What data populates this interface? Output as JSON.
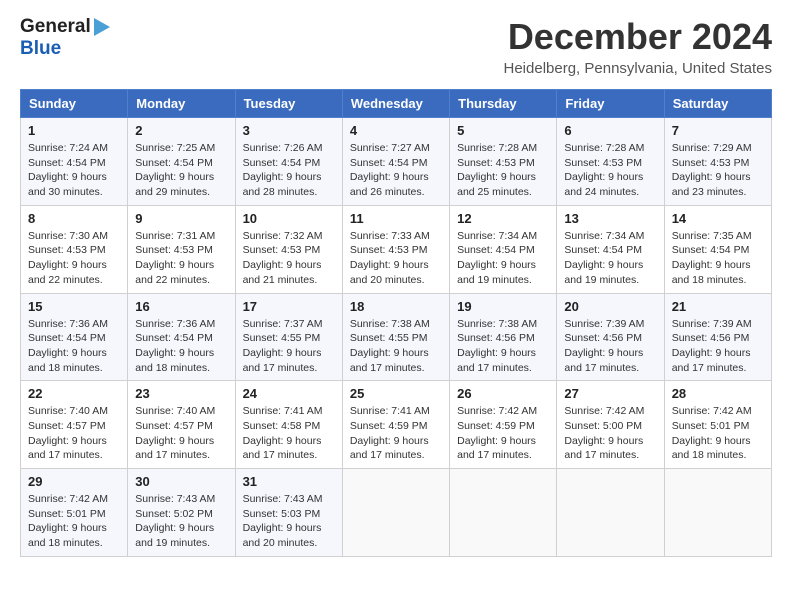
{
  "header": {
    "logo_general": "General",
    "logo_blue": "Blue",
    "title": "December 2024",
    "subtitle": "Heidelberg, Pennsylvania, United States"
  },
  "calendar": {
    "weekdays": [
      "Sunday",
      "Monday",
      "Tuesday",
      "Wednesday",
      "Thursday",
      "Friday",
      "Saturday"
    ],
    "weeks": [
      [
        {
          "day": "1",
          "sunrise": "Sunrise: 7:24 AM",
          "sunset": "Sunset: 4:54 PM",
          "daylight": "Daylight: 9 hours and 30 minutes."
        },
        {
          "day": "2",
          "sunrise": "Sunrise: 7:25 AM",
          "sunset": "Sunset: 4:54 PM",
          "daylight": "Daylight: 9 hours and 29 minutes."
        },
        {
          "day": "3",
          "sunrise": "Sunrise: 7:26 AM",
          "sunset": "Sunset: 4:54 PM",
          "daylight": "Daylight: 9 hours and 28 minutes."
        },
        {
          "day": "4",
          "sunrise": "Sunrise: 7:27 AM",
          "sunset": "Sunset: 4:54 PM",
          "daylight": "Daylight: 9 hours and 26 minutes."
        },
        {
          "day": "5",
          "sunrise": "Sunrise: 7:28 AM",
          "sunset": "Sunset: 4:53 PM",
          "daylight": "Daylight: 9 hours and 25 minutes."
        },
        {
          "day": "6",
          "sunrise": "Sunrise: 7:28 AM",
          "sunset": "Sunset: 4:53 PM",
          "daylight": "Daylight: 9 hours and 24 minutes."
        },
        {
          "day": "7",
          "sunrise": "Sunrise: 7:29 AM",
          "sunset": "Sunset: 4:53 PM",
          "daylight": "Daylight: 9 hours and 23 minutes."
        }
      ],
      [
        {
          "day": "8",
          "sunrise": "Sunrise: 7:30 AM",
          "sunset": "Sunset: 4:53 PM",
          "daylight": "Daylight: 9 hours and 22 minutes."
        },
        {
          "day": "9",
          "sunrise": "Sunrise: 7:31 AM",
          "sunset": "Sunset: 4:53 PM",
          "daylight": "Daylight: 9 hours and 22 minutes."
        },
        {
          "day": "10",
          "sunrise": "Sunrise: 7:32 AM",
          "sunset": "Sunset: 4:53 PM",
          "daylight": "Daylight: 9 hours and 21 minutes."
        },
        {
          "day": "11",
          "sunrise": "Sunrise: 7:33 AM",
          "sunset": "Sunset: 4:53 PM",
          "daylight": "Daylight: 9 hours and 20 minutes."
        },
        {
          "day": "12",
          "sunrise": "Sunrise: 7:34 AM",
          "sunset": "Sunset: 4:54 PM",
          "daylight": "Daylight: 9 hours and 19 minutes."
        },
        {
          "day": "13",
          "sunrise": "Sunrise: 7:34 AM",
          "sunset": "Sunset: 4:54 PM",
          "daylight": "Daylight: 9 hours and 19 minutes."
        },
        {
          "day": "14",
          "sunrise": "Sunrise: 7:35 AM",
          "sunset": "Sunset: 4:54 PM",
          "daylight": "Daylight: 9 hours and 18 minutes."
        }
      ],
      [
        {
          "day": "15",
          "sunrise": "Sunrise: 7:36 AM",
          "sunset": "Sunset: 4:54 PM",
          "daylight": "Daylight: 9 hours and 18 minutes."
        },
        {
          "day": "16",
          "sunrise": "Sunrise: 7:36 AM",
          "sunset": "Sunset: 4:54 PM",
          "daylight": "Daylight: 9 hours and 18 minutes."
        },
        {
          "day": "17",
          "sunrise": "Sunrise: 7:37 AM",
          "sunset": "Sunset: 4:55 PM",
          "daylight": "Daylight: 9 hours and 17 minutes."
        },
        {
          "day": "18",
          "sunrise": "Sunrise: 7:38 AM",
          "sunset": "Sunset: 4:55 PM",
          "daylight": "Daylight: 9 hours and 17 minutes."
        },
        {
          "day": "19",
          "sunrise": "Sunrise: 7:38 AM",
          "sunset": "Sunset: 4:56 PM",
          "daylight": "Daylight: 9 hours and 17 minutes."
        },
        {
          "day": "20",
          "sunrise": "Sunrise: 7:39 AM",
          "sunset": "Sunset: 4:56 PM",
          "daylight": "Daylight: 9 hours and 17 minutes."
        },
        {
          "day": "21",
          "sunrise": "Sunrise: 7:39 AM",
          "sunset": "Sunset: 4:56 PM",
          "daylight": "Daylight: 9 hours and 17 minutes."
        }
      ],
      [
        {
          "day": "22",
          "sunrise": "Sunrise: 7:40 AM",
          "sunset": "Sunset: 4:57 PM",
          "daylight": "Daylight: 9 hours and 17 minutes."
        },
        {
          "day": "23",
          "sunrise": "Sunrise: 7:40 AM",
          "sunset": "Sunset: 4:57 PM",
          "daylight": "Daylight: 9 hours and 17 minutes."
        },
        {
          "day": "24",
          "sunrise": "Sunrise: 7:41 AM",
          "sunset": "Sunset: 4:58 PM",
          "daylight": "Daylight: 9 hours and 17 minutes."
        },
        {
          "day": "25",
          "sunrise": "Sunrise: 7:41 AM",
          "sunset": "Sunset: 4:59 PM",
          "daylight": "Daylight: 9 hours and 17 minutes."
        },
        {
          "day": "26",
          "sunrise": "Sunrise: 7:42 AM",
          "sunset": "Sunset: 4:59 PM",
          "daylight": "Daylight: 9 hours and 17 minutes."
        },
        {
          "day": "27",
          "sunrise": "Sunrise: 7:42 AM",
          "sunset": "Sunset: 5:00 PM",
          "daylight": "Daylight: 9 hours and 17 minutes."
        },
        {
          "day": "28",
          "sunrise": "Sunrise: 7:42 AM",
          "sunset": "Sunset: 5:01 PM",
          "daylight": "Daylight: 9 hours and 18 minutes."
        }
      ],
      [
        {
          "day": "29",
          "sunrise": "Sunrise: 7:42 AM",
          "sunset": "Sunset: 5:01 PM",
          "daylight": "Daylight: 9 hours and 18 minutes."
        },
        {
          "day": "30",
          "sunrise": "Sunrise: 7:43 AM",
          "sunset": "Sunset: 5:02 PM",
          "daylight": "Daylight: 9 hours and 19 minutes."
        },
        {
          "day": "31",
          "sunrise": "Sunrise: 7:43 AM",
          "sunset": "Sunset: 5:03 PM",
          "daylight": "Daylight: 9 hours and 20 minutes."
        },
        null,
        null,
        null,
        null
      ]
    ]
  }
}
